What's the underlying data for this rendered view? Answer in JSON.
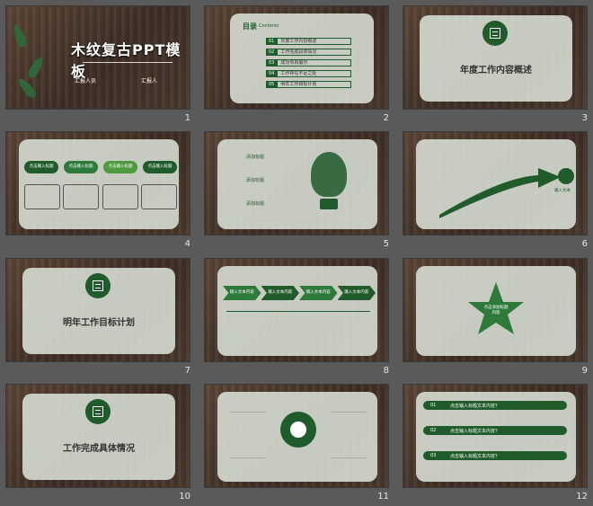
{
  "slides": [
    {
      "num": "1",
      "title": "木纹复古PPT模板",
      "sub1": "汇报人员",
      "sub2": "汇报人"
    },
    {
      "num": "2",
      "title": "目录",
      "title_en": "Contents",
      "items": [
        "年度工作内容概述",
        "工作完成具体情况",
        "成功项目展示",
        "工作存在不足之处",
        "明年工作目标计划"
      ],
      "indices": [
        "01",
        "02",
        "03",
        "04",
        "05"
      ]
    },
    {
      "num": "3",
      "title": "年度工作内容概述"
    },
    {
      "num": "4",
      "labels": [
        "点击输入标题",
        "点击输入标题",
        "点击输入标题",
        "点击输入标题"
      ]
    },
    {
      "num": "5",
      "labels": [
        "添加标题",
        "添加标题",
        "添加标题"
      ]
    },
    {
      "num": "6",
      "label": "输入文本"
    },
    {
      "num": "7",
      "title": "明年工作目标计划"
    },
    {
      "num": "8",
      "labels": [
        "输入文本内容",
        "输入文本内容",
        "输入文本内容",
        "输入文本内容"
      ]
    },
    {
      "num": "9",
      "center": "点击添加标题内容",
      "indices": [
        "01",
        "02",
        "03",
        "04",
        "05"
      ]
    },
    {
      "num": "10",
      "title": "工作完成具体情况"
    },
    {
      "num": "11"
    },
    {
      "num": "12",
      "labels": [
        "点击输入标题文本内容？",
        "点击输入标题文本内容？",
        "点击输入标题文本内容？"
      ],
      "indices": [
        "01",
        "02",
        "03"
      ]
    }
  ],
  "colors": {
    "accent": "#1f5b2b"
  }
}
